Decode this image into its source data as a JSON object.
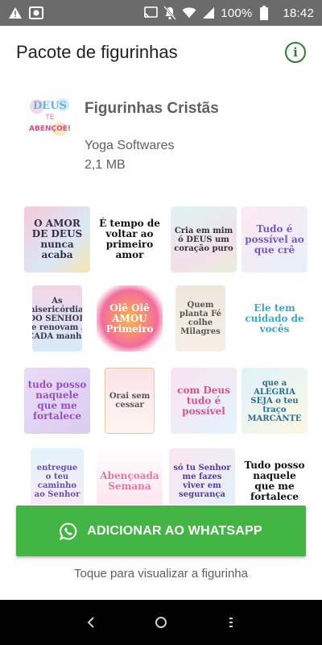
{
  "status_bar": {
    "battery_percent": "100%",
    "time": "18:42",
    "icons": [
      "warning-icon",
      "photo-icon",
      "cast-icon",
      "mute-icon",
      "wifi-icon",
      "signal-icon",
      "battery-icon"
    ]
  },
  "app_bar": {
    "title": "Pacote de figurinhas",
    "info_icon": "info-icon"
  },
  "pack": {
    "icon_text_1": "DEUS",
    "icon_text_2": "TE",
    "icon_text_3": "ABENÇOE!",
    "name": "Figurinhas Cristãs",
    "author": "Yoga Softwares",
    "size": "2,1 MB"
  },
  "stickers": [
    {
      "text": "O AMOR DE DEUS nunca acaba"
    },
    {
      "text": "É tempo de voltar ao primeiro amor"
    },
    {
      "text": "Cria em mim ó DEUS um coração puro"
    },
    {
      "text": "Tudo é possível ao que crê"
    },
    {
      "text": "As misericórdias DO SENHOR se renovam A CADA manhã"
    },
    {
      "text": "Olê Olê AMOU Primeiro"
    },
    {
      "text": "Quem planta Fé colhe Milagres"
    },
    {
      "text": "Ele tem cuidado de vocês"
    },
    {
      "text": "tudo posso naquele que me fortalece"
    },
    {
      "text": "Orai sem cessar"
    },
    {
      "text": "com Deus tudo é possível"
    },
    {
      "text": "que a ALEGRIA SEJA o teu traço MARCANTE"
    },
    {
      "text": "entregue o teu caminho ao Senhor"
    },
    {
      "text": "Abençoada Semana"
    },
    {
      "text": "só tu Senhor me fazes viver em segurança"
    },
    {
      "text": "Tudo posso naquele que me fortalece"
    }
  ],
  "add_button": {
    "label": "ADICIONAR AO WHATSAPP",
    "icon": "whatsapp-icon",
    "color": "#43b544"
  },
  "hint": "Toque para visualizar a figurinha",
  "nav": {
    "back_icon": "back-icon",
    "home_icon": "home-icon",
    "recents_icon": "recents-icon"
  }
}
